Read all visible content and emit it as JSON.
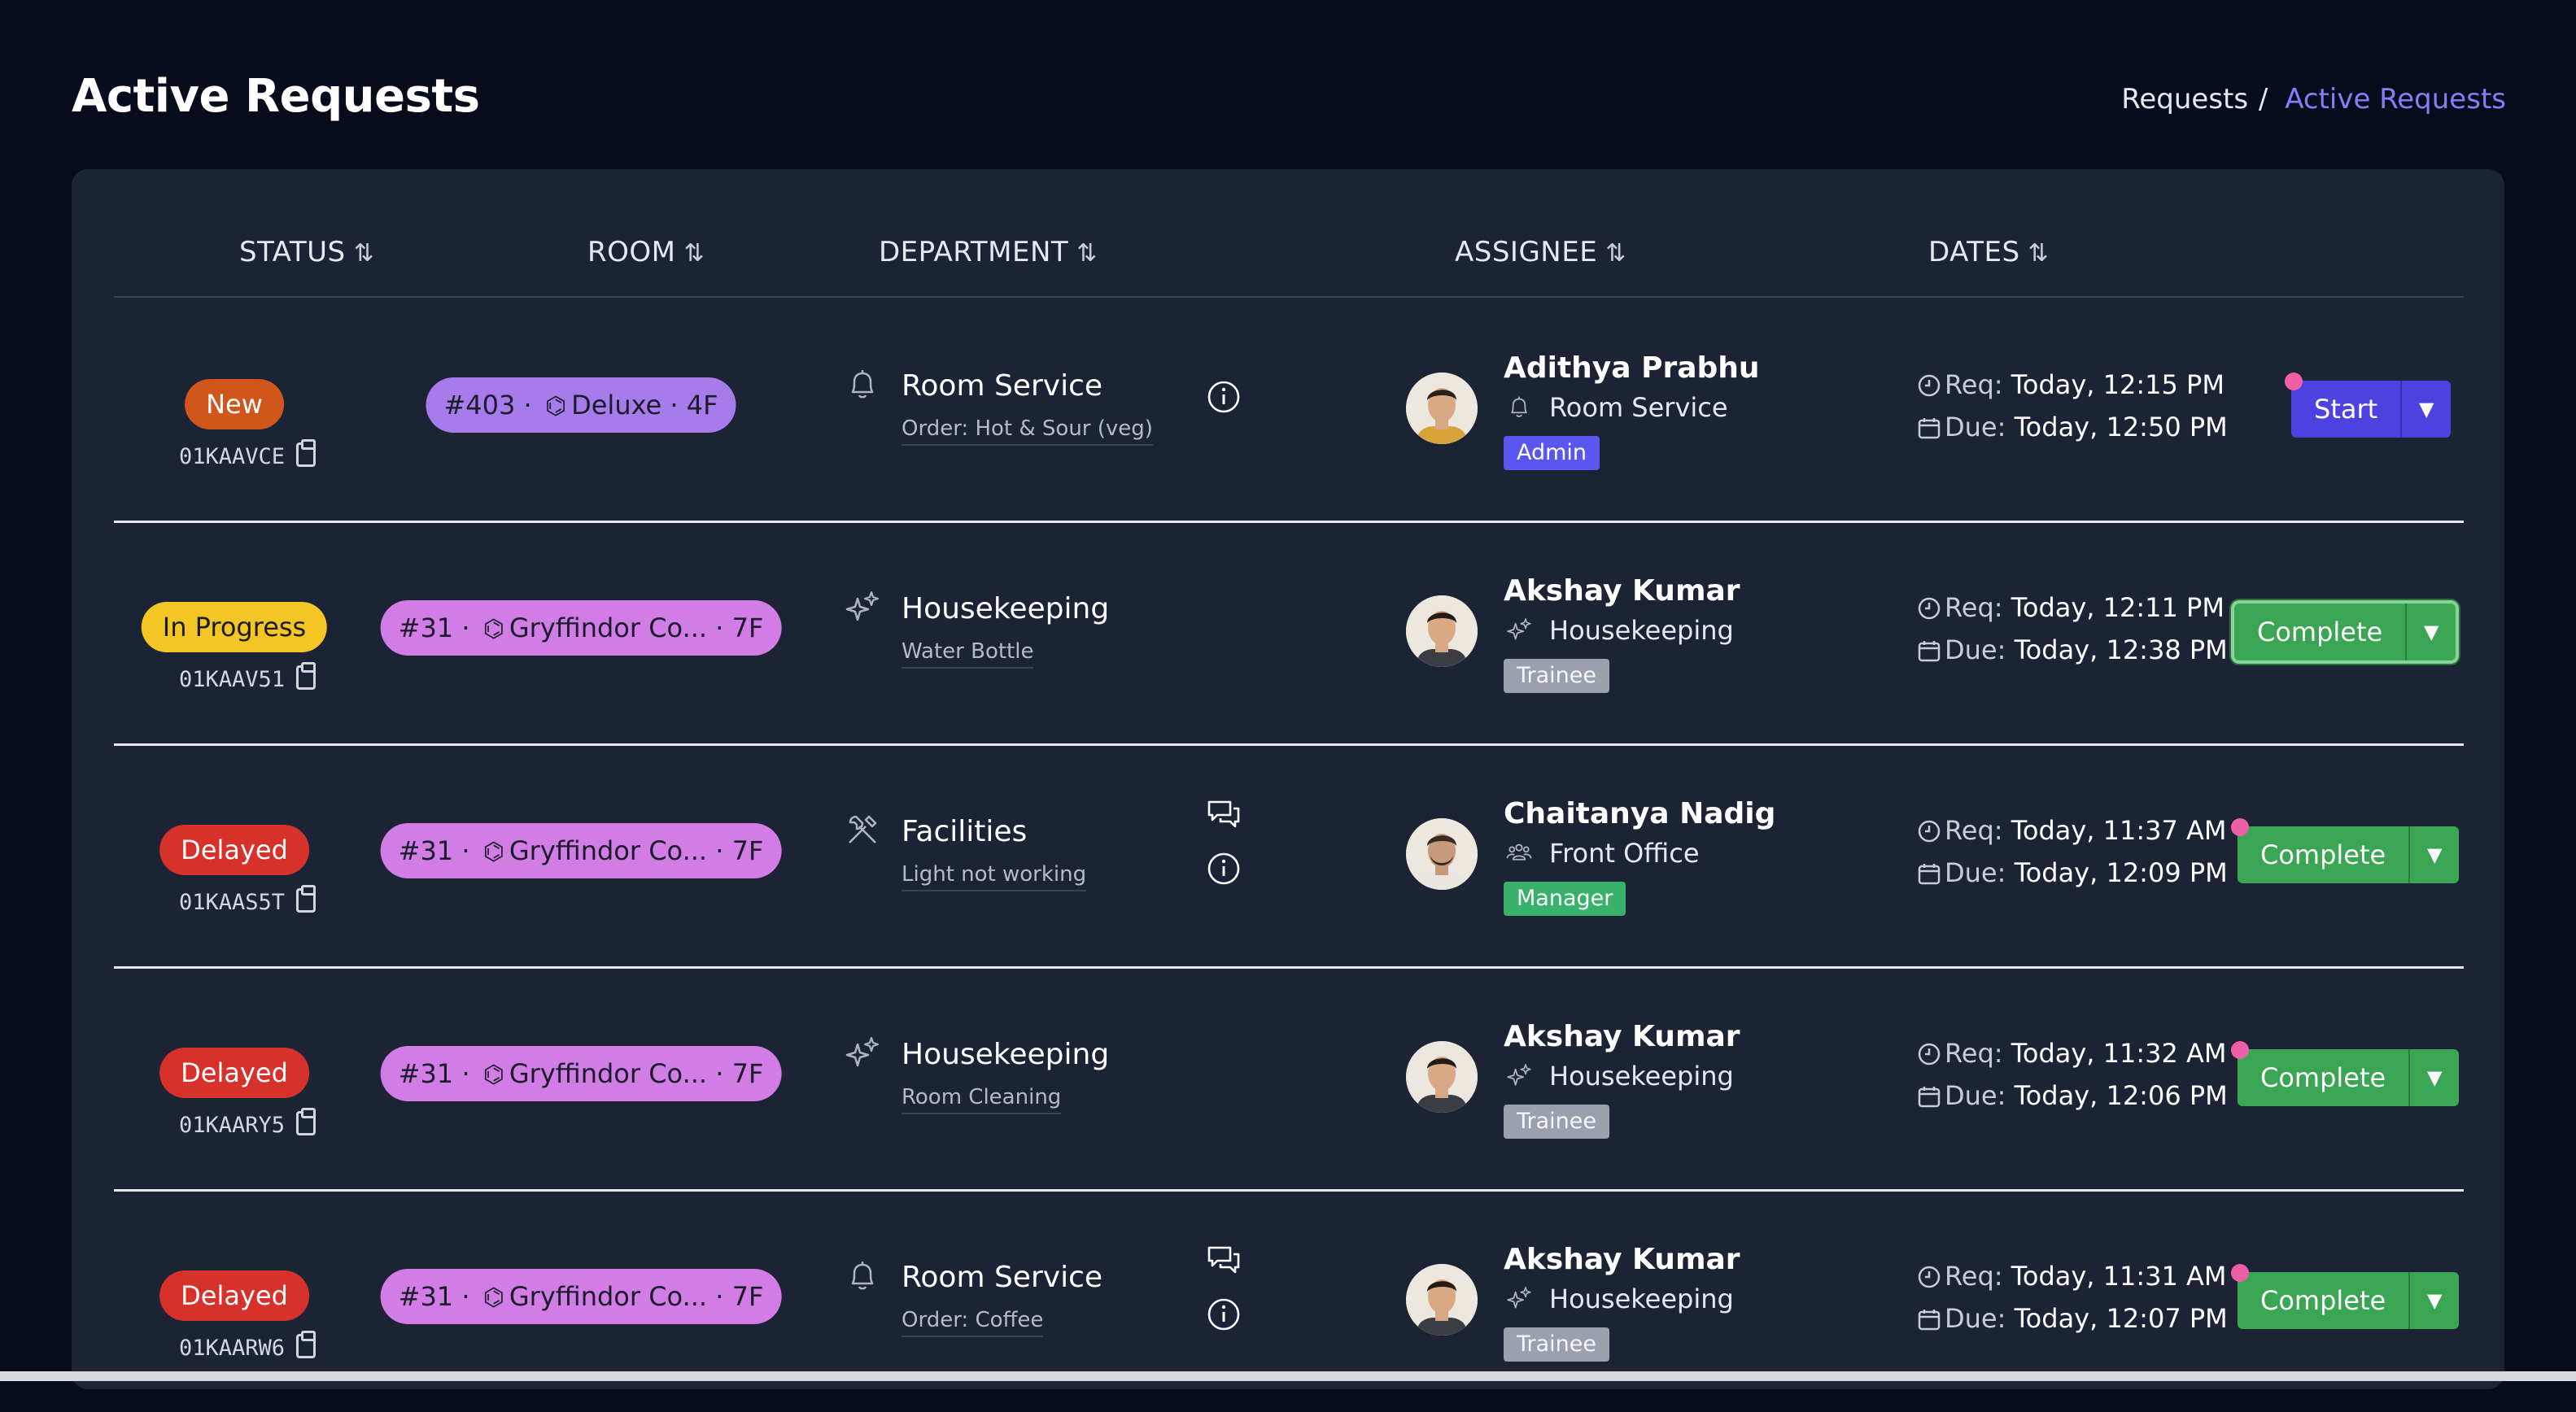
{
  "header": {
    "title": "Active Requests",
    "breadcrumb": {
      "parent": "Requests",
      "separator": "/",
      "current": "Active Requests"
    }
  },
  "columns": {
    "status": "STATUS",
    "room": "ROOM",
    "department": "DEPARTMENT",
    "assignee": "ASSIGNEE",
    "dates": "DATES",
    "sort_glyph": "⇅"
  },
  "rows": [
    {
      "status": "New",
      "status_color": "#d0561b",
      "id": "01KAAVCE",
      "room": {
        "number": "#403",
        "type": "Deluxe",
        "floor": "4F",
        "color": "#a77bea"
      },
      "department": {
        "name": "Room Service",
        "icon": "bell-icon",
        "detail": "Order: Hot & Sour (veg)",
        "has_chat": false,
        "has_info": true
      },
      "assignee": {
        "name": "Adithya Prabhu",
        "department": "Room Service",
        "dept_icon": "bell-icon",
        "role": "Admin"
      },
      "dates": {
        "req_label": "Req:",
        "req": "Today, 12:15 PM",
        "due_label": "Due:",
        "due": "Today, 12:50 PM"
      },
      "action": "Start",
      "action_dot": true
    },
    {
      "status": "In Progress",
      "status_color": "#f3c623",
      "id": "01KAAV51",
      "room": {
        "number": "#31",
        "type": "Gryffindor Co...",
        "floor": "7F",
        "color": "#d27ce6"
      },
      "department": {
        "name": "Housekeeping",
        "icon": "sparkles-icon",
        "detail": "Water Bottle",
        "has_chat": false,
        "has_info": false
      },
      "assignee": {
        "name": "Akshay Kumar",
        "department": "Housekeeping",
        "dept_icon": "sparkles-icon",
        "role": "Trainee"
      },
      "dates": {
        "req_label": "Req:",
        "req": "Today, 12:11 PM",
        "due_label": "Due:",
        "due": "Today, 12:38 PM"
      },
      "action": "Complete",
      "action_dot": false
    },
    {
      "status": "Delayed",
      "status_color": "#d6312b",
      "id": "01KAAS5T",
      "room": {
        "number": "#31",
        "type": "Gryffindor Co...",
        "floor": "7F",
        "color": "#d27ce6"
      },
      "department": {
        "name": "Facilities",
        "icon": "tools-icon",
        "detail": "Light not working",
        "has_chat": true,
        "has_info": true
      },
      "assignee": {
        "name": "Chaitanya Nadig",
        "department": "Front Office",
        "dept_icon": "users-icon",
        "role": "Manager"
      },
      "dates": {
        "req_label": "Req:",
        "req": "Today, 11:37 AM",
        "due_label": "Due:",
        "due": "Today, 12:09 PM"
      },
      "action": "Complete",
      "action_dot": true
    },
    {
      "status": "Delayed",
      "status_color": "#d6312b",
      "id": "01KAARY5",
      "room": {
        "number": "#31",
        "type": "Gryffindor Co...",
        "floor": "7F",
        "color": "#d27ce6"
      },
      "department": {
        "name": "Housekeeping",
        "icon": "sparkles-icon",
        "detail": "Room Cleaning",
        "has_chat": false,
        "has_info": false
      },
      "assignee": {
        "name": "Akshay Kumar",
        "department": "Housekeeping",
        "dept_icon": "sparkles-icon",
        "role": "Trainee"
      },
      "dates": {
        "req_label": "Req:",
        "req": "Today, 11:32 AM",
        "due_label": "Due:",
        "due": "Today, 12:06 PM"
      },
      "action": "Complete",
      "action_dot": true
    },
    {
      "status": "Delayed",
      "status_color": "#d6312b",
      "id": "01KAARW6",
      "room": {
        "number": "#31",
        "type": "Gryffindor Co...",
        "floor": "7F",
        "color": "#d27ce6"
      },
      "department": {
        "name": "Room Service",
        "icon": "bell-icon",
        "detail": "Order: Coffee",
        "has_chat": true,
        "has_info": true
      },
      "assignee": {
        "name": "Akshay Kumar",
        "department": "Housekeeping",
        "dept_icon": "sparkles-icon",
        "role": "Trainee"
      },
      "dates": {
        "req_label": "Req:",
        "req": "Today, 11:31 AM",
        "due_label": "Due:",
        "due": "Today, 12:07 PM"
      },
      "action": "Complete",
      "action_dot": true
    }
  ],
  "colors": {
    "background": "#070c1d",
    "card": "#1b2335",
    "accent": "#8b7cf6",
    "start": "#4d42e0",
    "complete": "#3aa653",
    "dot": "#ef5fa7"
  }
}
